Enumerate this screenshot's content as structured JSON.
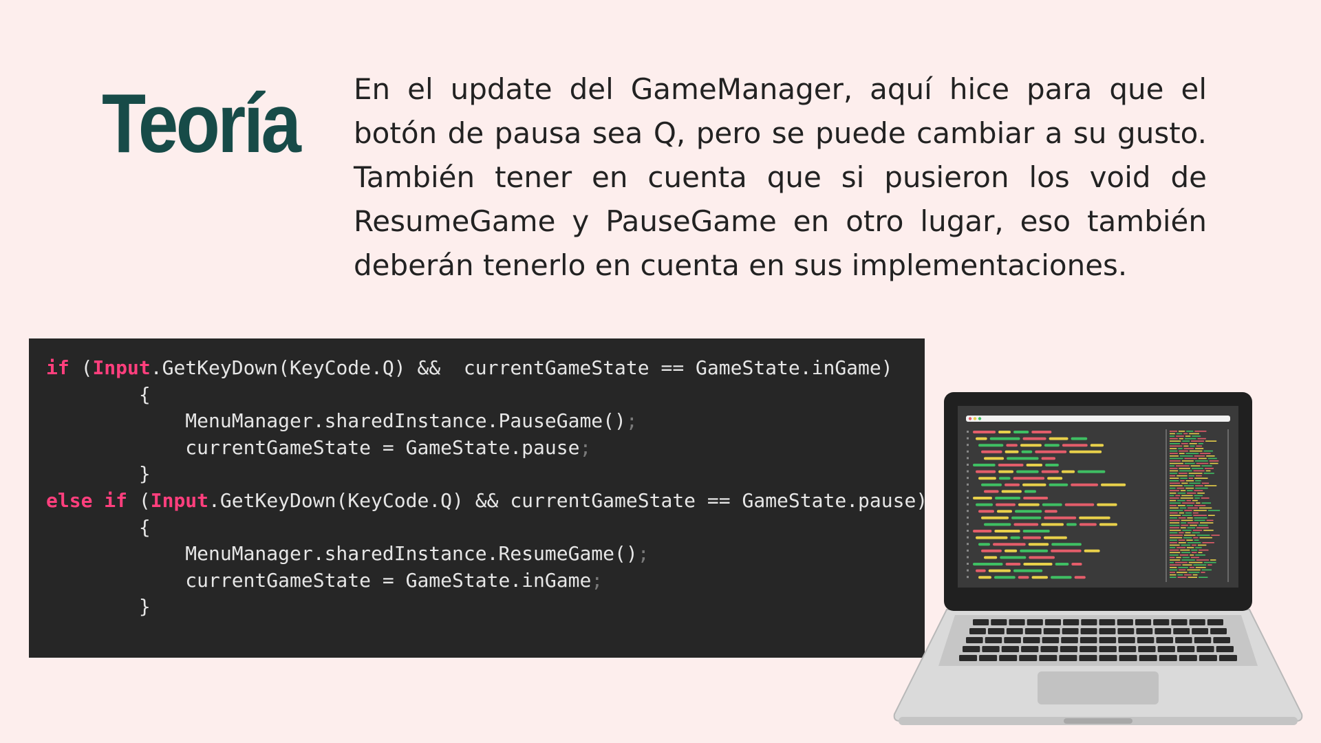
{
  "title": "Teoría",
  "paragraph": "En el update del GameManager, aquí hice para que el botón de pausa sea Q, pero se puede cambiar a su gusto. También tener en cuenta que si pusieron los void de ResumeGame y PauseGame en otro lugar, eso también deberán tenerlo en cuenta en sus implementaciones.",
  "code": {
    "line1": {
      "kw": "if",
      "open": " (",
      "input": "Input",
      "rest": ".GetKeyDown(KeyCode.Q) &&  currentGameState == GameState.inGame)"
    },
    "line2": "        {",
    "line3": {
      "text": "            MenuManager.sharedInstance.PauseGame()",
      "semi": ";"
    },
    "line4": {
      "text": "            currentGameState = GameState.pause",
      "semi": ";"
    },
    "line5": "        }",
    "line6": {
      "kw": "else if",
      "open": " (",
      "input": "Input",
      "rest": ".GetKeyDown(KeyCode.Q) && currentGameState == GameState.pause)"
    },
    "line7": "        {",
    "line8": {
      "text": "            MenuManager.sharedInstance.ResumeGame()",
      "semi": ";"
    },
    "line9": {
      "text": "            currentGameState = GameState.inGame",
      "semi": ";"
    },
    "line10": "        }"
  }
}
